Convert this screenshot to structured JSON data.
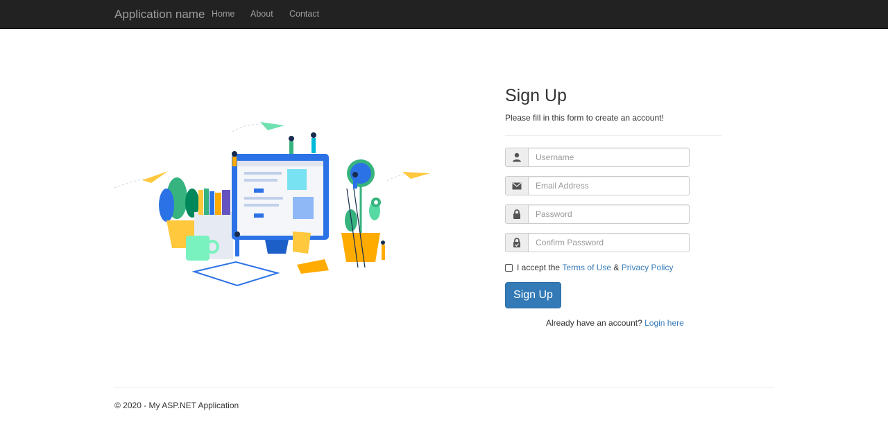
{
  "navbar": {
    "brand": "Application name",
    "links": [
      "Home",
      "About",
      "Contact"
    ],
    "background": "#222222",
    "link_color": "#9d9d9d"
  },
  "illustration": {
    "semantic": "workspace-illustration",
    "accent_colors": [
      "#2b72e6",
      "#ffc83d",
      "#36b37e"
    ]
  },
  "form": {
    "title": "Sign Up",
    "subtitle": "Please fill in this form to create an account!",
    "fields": [
      {
        "icon": "user-icon",
        "placeholder": "Username"
      },
      {
        "icon": "envelope-icon",
        "placeholder": "Email Address"
      },
      {
        "icon": "lock-icon",
        "placeholder": "Password"
      },
      {
        "icon": "lock-check-icon",
        "placeholder": "Confirm Password"
      }
    ],
    "terms": {
      "prefix": "I accept the",
      "terms_link": "Terms of Use",
      "amp": "&",
      "privacy_link": "Privacy Policy"
    },
    "submit_label": "Sign Up",
    "login_prompt": "Already have an account?",
    "login_link": "Login here",
    "accent": "#337ab7"
  },
  "footer": {
    "text": "© 2020 - My ASP.NET Application"
  }
}
